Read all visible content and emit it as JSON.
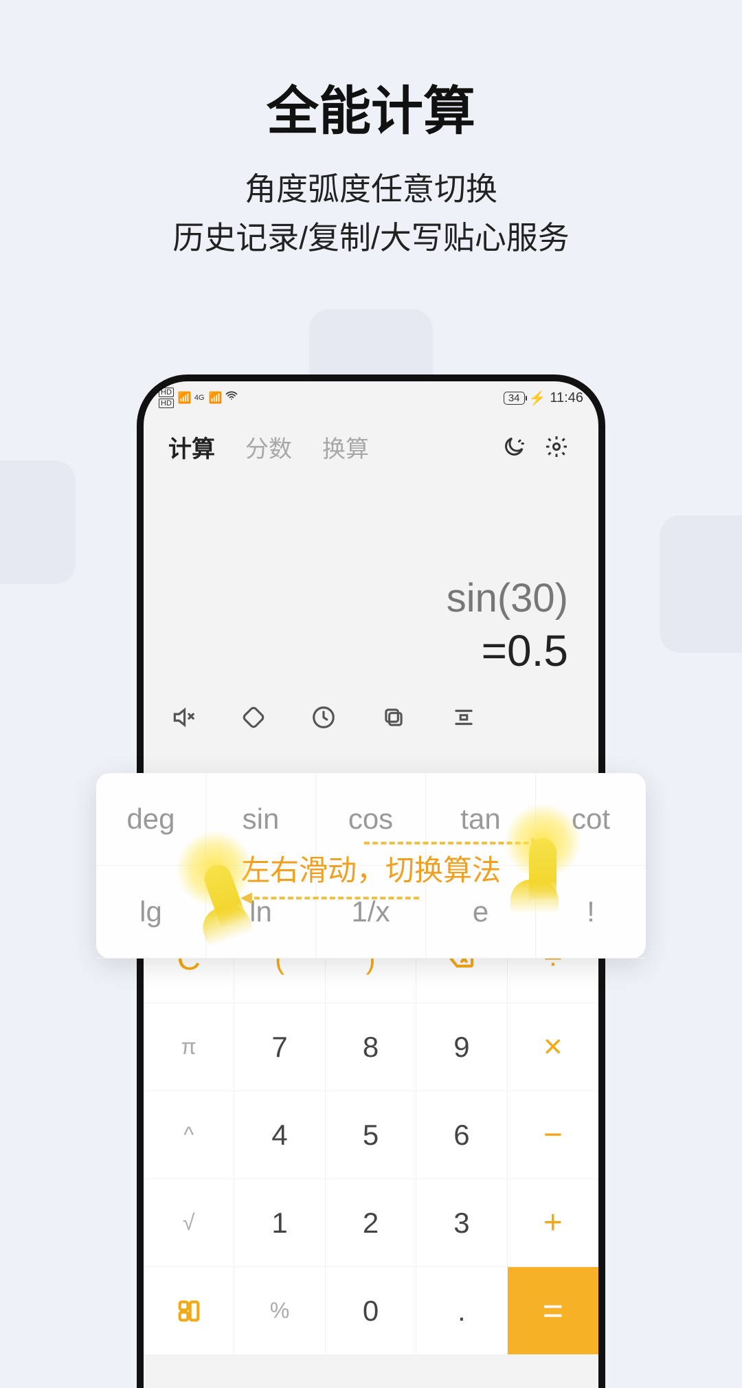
{
  "marketing": {
    "title": "全能计算",
    "subtitle_line1": "角度弧度任意切换",
    "subtitle_line2": "历史记录/复制/大写贴心服务"
  },
  "statusbar": {
    "battery": "34",
    "time": "11:46"
  },
  "tabs": {
    "calculate": "计算",
    "fraction": "分数",
    "convert": "换算"
  },
  "display": {
    "expression": "sin(30)",
    "result": "=0.5"
  },
  "sci": {
    "row1": [
      "deg",
      "sin",
      "cos",
      "tan",
      "cot"
    ],
    "row2": [
      "lg",
      "ln",
      "1/x",
      "e",
      "!"
    ]
  },
  "swipe_hint": "左右滑动，切换算法",
  "keypad": {
    "row1": [
      "C",
      "(",
      ")",
      "⌫",
      "÷"
    ],
    "row2": [
      "π",
      "7",
      "8",
      "9",
      "×"
    ],
    "row3": [
      "^",
      "4",
      "5",
      "6",
      "−"
    ],
    "row4": [
      "√",
      "1",
      "2",
      "3",
      "+"
    ],
    "row5": [
      "⇋",
      "%",
      "0",
      ".",
      "="
    ]
  }
}
